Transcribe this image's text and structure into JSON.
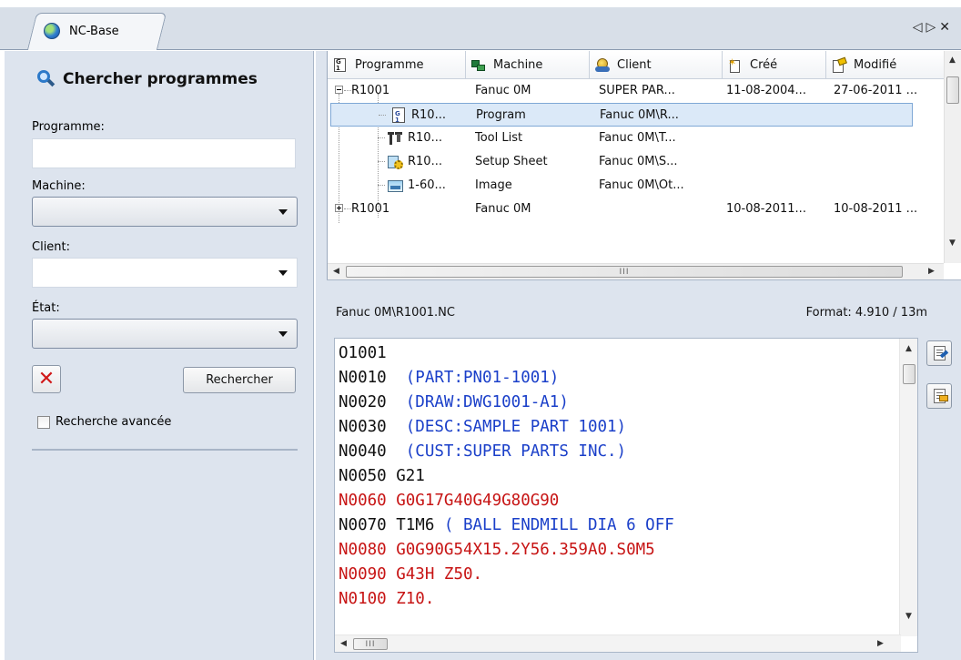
{
  "tab": {
    "title": "NC-Base",
    "prev_arrow": "◁",
    "next_arrow": "▷",
    "close": "✕"
  },
  "search_panel": {
    "title": "Chercher programmes",
    "program_label": "Programme:",
    "program_value": "",
    "machine_label": "Machine:",
    "machine_value": "",
    "client_label": "Client:",
    "client_value": "",
    "state_label": "État:",
    "state_value": "",
    "clear_symbol": "✕",
    "search_button": "Rechercher",
    "advanced_label": "Recherche avancée",
    "advanced_checked": false
  },
  "program_list": {
    "columns": [
      "Programme",
      "Machine",
      "Client",
      "Créé",
      "Modifié"
    ],
    "rows": [
      {
        "expander": "minus",
        "name": "R1001",
        "machine": "Fanuc 0M",
        "client": "SUPER PAR...",
        "created": "11-08-2004...",
        "modified": "27-06-2011 ..."
      },
      {
        "icon": "nc-program-icon",
        "name": "R10...",
        "machine": "Program",
        "client": "Fanuc 0M\\R...",
        "selected": true
      },
      {
        "icon": "tool-list-icon",
        "name": "R10...",
        "machine": "Tool List",
        "client": "Fanuc 0M\\T..."
      },
      {
        "icon": "setup-sheet-icon",
        "name": "R10...",
        "machine": "Setup Sheet",
        "client": "Fanuc 0M\\S..."
      },
      {
        "icon": "image-file-icon",
        "name": "1-60...",
        "machine": "Image",
        "client": "Fanuc 0M\\Ot..."
      },
      {
        "expander": "plus",
        "name": "R1001",
        "machine": "Fanuc 0M",
        "client": "",
        "created": "10-08-2011...",
        "modified": "10-08-2011 ..."
      }
    ],
    "hscroll_grip": "III"
  },
  "editor": {
    "path": "Fanuc 0M\\R1001.NC",
    "format": "Format: 4.910 / 13m",
    "lines": [
      {
        "n": "O1001",
        "rest": "",
        "style": "plain"
      },
      {
        "n": "N0010",
        "rest": "  (PART:PN01-1001)",
        "style": "comment"
      },
      {
        "n": "N0020",
        "rest": "  (DRAW:DWG1001-A1)",
        "style": "comment"
      },
      {
        "n": "N0030",
        "rest": "  (DESC:SAMPLE PART 1001)",
        "style": "comment"
      },
      {
        "n": "N0040",
        "rest": "  (CUST:SUPER PARTS INC.)",
        "style": "comment"
      },
      {
        "n": "N0050",
        "rest": " G21",
        "style": "plain"
      },
      {
        "n": "N0060",
        "rest": " G0G17G40G49G80G90",
        "style": "red"
      },
      {
        "n": "N0070",
        "rest": " T1M6",
        "comment": " ( BALL ENDMILL DIA 6 OFF",
        "style": "mixed"
      },
      {
        "n": "N0080",
        "rest": " G0G90G54X15.2Y56.359A0.S0M5",
        "style": "red"
      },
      {
        "n": "N0090",
        "rest": " G43H Z50.",
        "style": "red"
      },
      {
        "n": "N0100",
        "rest": " Z10.",
        "style": "red"
      }
    ],
    "hscroll_grip": "III"
  }
}
